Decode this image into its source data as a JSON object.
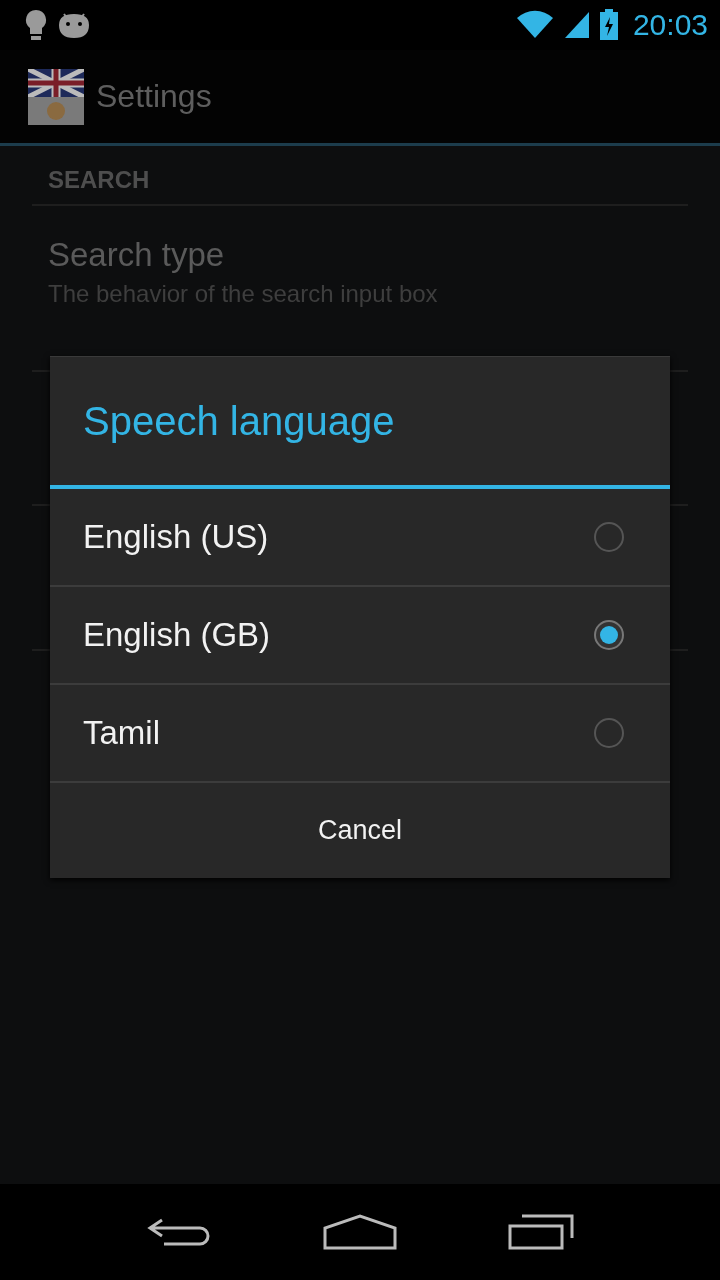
{
  "status_bar": {
    "time": "20:03"
  },
  "action_bar": {
    "title": "Settings"
  },
  "settings": {
    "section": "SEARCH",
    "items": [
      {
        "title": "Search type",
        "summary": "The behavior of the search input box"
      }
    ]
  },
  "dialog": {
    "title": "Speech language",
    "options": [
      {
        "label": "English (US)",
        "selected": false
      },
      {
        "label": "English (GB)",
        "selected": true
      },
      {
        "label": "Tamil",
        "selected": false
      }
    ],
    "buttons": [
      "Cancel"
    ]
  }
}
